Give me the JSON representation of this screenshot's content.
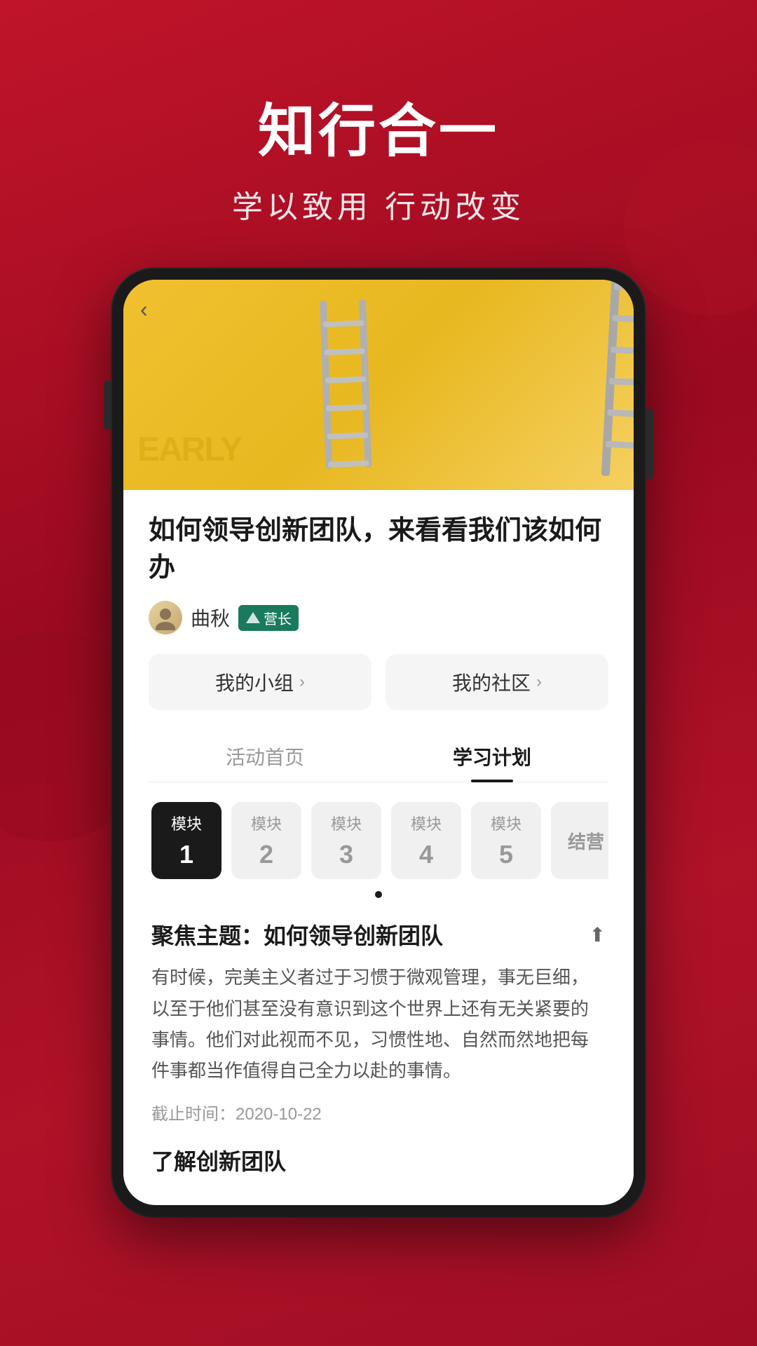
{
  "header": {
    "title": "知行合一",
    "subtitle": "学以致用 行动改变"
  },
  "phone": {
    "back_button": "‹",
    "article": {
      "title": "如何领导创新团队，来看看我们该如何办",
      "author_name": "曲秋",
      "author_badge": "营长",
      "nav": [
        {
          "label": "我的小组",
          "arrow": "›"
        },
        {
          "label": "我的社区",
          "arrow": "›"
        }
      ]
    },
    "tabs": [
      {
        "label": "活动首页",
        "active": false
      },
      {
        "label": "学习计划",
        "active": true
      }
    ],
    "modules": [
      {
        "label": "模块",
        "num": "1",
        "active": true
      },
      {
        "label": "模块",
        "num": "2",
        "active": false
      },
      {
        "label": "模块",
        "num": "3",
        "active": false
      },
      {
        "label": "模块",
        "num": "4",
        "active": false
      },
      {
        "label": "模块",
        "num": "5",
        "active": false
      },
      {
        "label": "结营",
        "num": "",
        "active": false
      }
    ],
    "focus": {
      "title": "聚焦主题：如何领导创新团队",
      "body": "有时候，完美主义者过于习惯于微观管理，事无巨细，以至于他们甚至没有意识到这个世界上还有无关紧要的事情。他们对此视而不见，习惯性地、自然而然地把每件事都当作值得自己全力以赴的事情。",
      "deadline_label": "截止时间：2020-10-22",
      "bottom_heading": "了解创新团队"
    }
  }
}
